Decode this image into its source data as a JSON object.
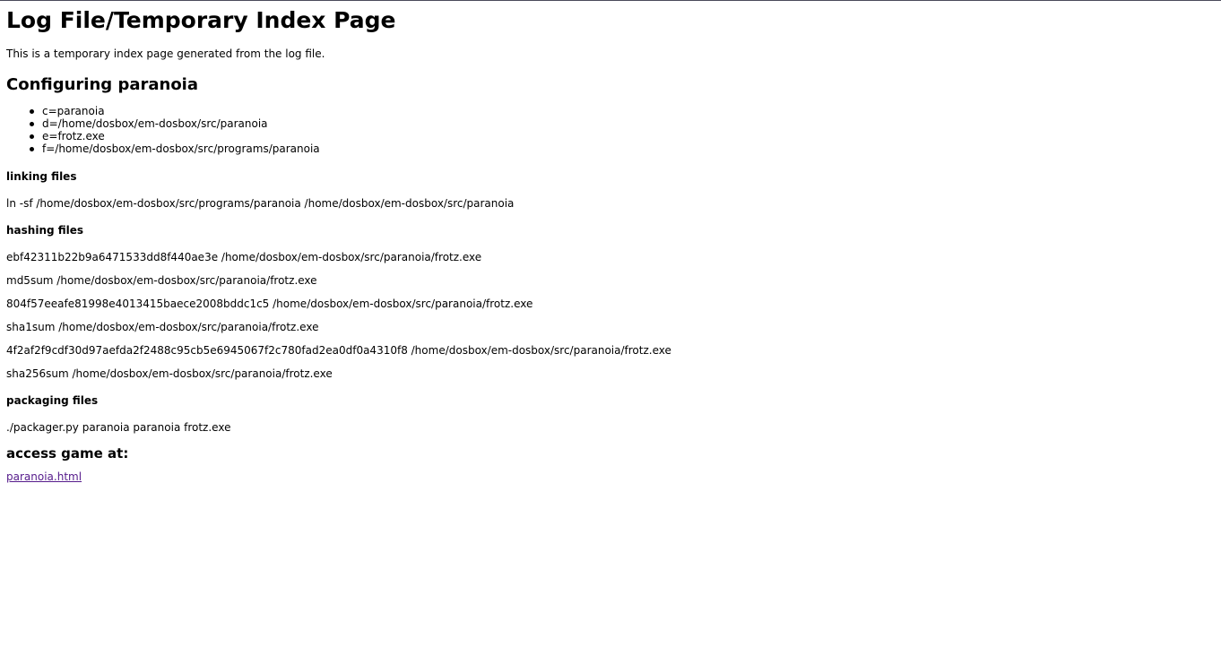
{
  "page_title": "Log File/Temporary Index Page",
  "intro": "This is a temporary index page generated from the log file.",
  "configure_heading": "Configuring paranoia",
  "params": [
    "c=paranoia",
    "d=/home/dosbox/em-dosbox/src/paranoia",
    "e=frotz.exe",
    "f=/home/dosbox/em-dosbox/src/programs/paranoia"
  ],
  "linking": {
    "label": "linking files",
    "command": "ln -sf /home/dosbox/em-dosbox/src/programs/paranoia /home/dosbox/em-dosbox/src/paranoia"
  },
  "hashing": {
    "label": "hashing files",
    "lines": [
      "ebf42311b22b9a6471533dd8f440ae3e /home/dosbox/em-dosbox/src/paranoia/frotz.exe",
      "md5sum /home/dosbox/em-dosbox/src/paranoia/frotz.exe",
      "804f57eeafe81998e4013415baece2008bddc1c5 /home/dosbox/em-dosbox/src/paranoia/frotz.exe",
      "sha1sum /home/dosbox/em-dosbox/src/paranoia/frotz.exe",
      "4f2af2f9cdf30d97aefda2f2488c95cb5e6945067f2c780fad2ea0df0a4310f8 /home/dosbox/em-dosbox/src/paranoia/frotz.exe",
      "sha256sum /home/dosbox/em-dosbox/src/paranoia/frotz.exe"
    ]
  },
  "packaging": {
    "label": "packaging files",
    "command": "./packager.py paranoia paranoia frotz.exe"
  },
  "access": {
    "heading": "access game at:",
    "link_text": "paranoia.html",
    "link_color": "#551a8b"
  }
}
